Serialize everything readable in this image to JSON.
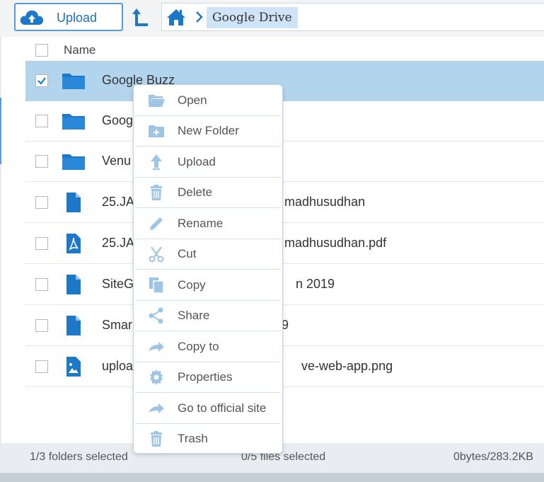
{
  "toolbar": {
    "upload_label": "Upload",
    "breadcrumb_current": "Google Drive"
  },
  "header": {
    "name_label": "Name"
  },
  "rows": [
    {
      "name": "Google Buzz",
      "type": "folder",
      "checked": true
    },
    {
      "name": "Goog",
      "type": "folder",
      "checked": false
    },
    {
      "name": "Venu",
      "type": "folder",
      "checked": false
    },
    {
      "name": "25.JA",
      "name_tail": "madhusudhan",
      "type": "file",
      "checked": false
    },
    {
      "name": "25.JA",
      "name_tail": "madhusudhan.pdf",
      "type": "pdf",
      "checked": false
    },
    {
      "name": "SiteG",
      "name_tail": "n 2019",
      "type": "file",
      "checked": false
    },
    {
      "name": "Smar",
      "name_tail": "9",
      "type": "file",
      "checked": false
    },
    {
      "name": "uploa",
      "name_tail": "ve-web-app.png",
      "type": "image",
      "checked": false
    }
  ],
  "context_menu": {
    "items": [
      {
        "label": "Open",
        "icon": "folder-open-icon"
      },
      {
        "label": "New Folder",
        "icon": "new-folder-icon"
      },
      {
        "label": "Upload",
        "icon": "upload-arrow-icon"
      },
      {
        "label": "Delete",
        "icon": "trash-icon"
      },
      {
        "label": "Rename",
        "icon": "pencil-icon"
      },
      {
        "label": "Cut",
        "icon": "scissors-icon"
      },
      {
        "label": "Copy",
        "icon": "copy-icon"
      },
      {
        "label": "Share",
        "icon": "share-icon"
      },
      {
        "label": "Copy to",
        "icon": "forward-arrow-icon"
      },
      {
        "label": "Properties",
        "icon": "gear-icon"
      },
      {
        "label": "Go to official site",
        "icon": "forward-arrow-icon"
      },
      {
        "label": "Trash",
        "icon": "trash-icon"
      }
    ]
  },
  "status": {
    "folders": "1/3 folders selected",
    "files": "0/5 files selected",
    "size": "0bytes/283.2KB"
  },
  "colors": {
    "accent": "#5b9bd5",
    "icon_blue": "#1e78c8",
    "selected_row": "#b3d4ed",
    "menu_icon": "#9ec5e6"
  }
}
